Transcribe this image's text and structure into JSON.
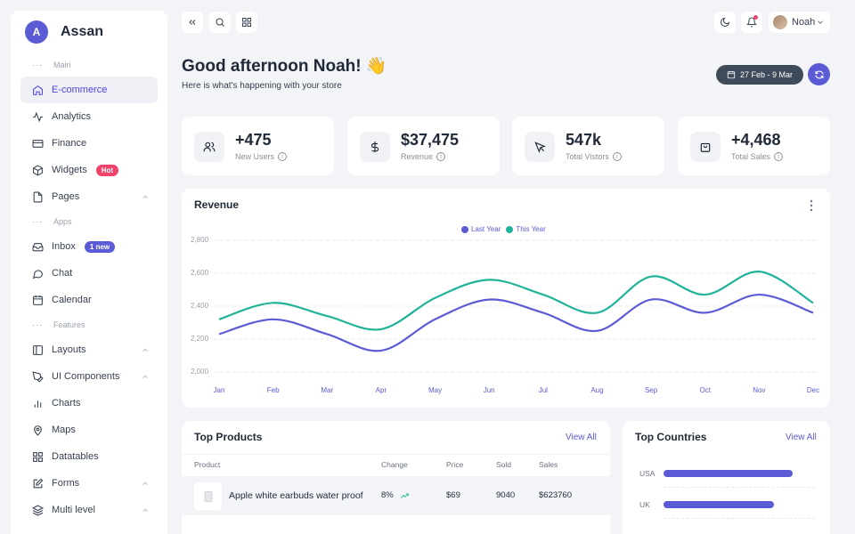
{
  "brand": {
    "initial": "A",
    "name": "Assan"
  },
  "sidebar": {
    "sections": [
      {
        "label": "Main"
      },
      {
        "label": "Apps"
      },
      {
        "label": "Features"
      }
    ],
    "items": [
      {
        "label": "E-commerce",
        "icon": "home-icon",
        "active": true
      },
      {
        "label": "Analytics",
        "icon": "activity-icon"
      },
      {
        "label": "Finance",
        "icon": "credit-card-icon"
      },
      {
        "label": "Widgets",
        "icon": "box-icon",
        "badge": "Hot"
      },
      {
        "label": "Pages",
        "icon": "file-icon",
        "has_chevron": true
      },
      {
        "label": "Inbox",
        "icon": "inbox-icon",
        "badge": "1 new"
      },
      {
        "label": "Chat",
        "icon": "message-icon"
      },
      {
        "label": "Calendar",
        "icon": "calendar-icon"
      },
      {
        "label": "Layouts",
        "icon": "layout-icon",
        "has_chevron": true
      },
      {
        "label": "UI Components",
        "icon": "pen-tool-icon",
        "has_chevron": true
      },
      {
        "label": "Charts",
        "icon": "bar-chart-icon"
      },
      {
        "label": "Maps",
        "icon": "map-pin-icon"
      },
      {
        "label": "Datatables",
        "icon": "grid-icon"
      },
      {
        "label": "Forms",
        "icon": "edit-icon",
        "has_chevron": true
      },
      {
        "label": "Multi level",
        "icon": "layers-icon",
        "has_chevron": true
      }
    ]
  },
  "topbar": {
    "user_name": "Noah"
  },
  "header": {
    "greeting": "Good afternoon Noah! 👋",
    "subtitle": "Here is what's happening with your store",
    "date_range": "27 Feb - 9 Mar"
  },
  "stats": [
    {
      "value": "+475",
      "label": "New Users",
      "icon": "users-icon"
    },
    {
      "value": "$37,475",
      "label": "Revenue",
      "icon": "dollar-icon"
    },
    {
      "value": "547k",
      "label": "Total Vistors",
      "icon": "cursor-icon"
    },
    {
      "value": "+4,468",
      "label": "Total Sales",
      "icon": "shopping-bag-icon"
    }
  ],
  "colors": {
    "accent": "#5b5bd6",
    "teal": "#20b39a",
    "hot": "#f0436a"
  },
  "chart_data": {
    "type": "line",
    "title": "Revenue",
    "categories": [
      "Jan",
      "Feb",
      "Mar",
      "Apr",
      "May",
      "Jun",
      "Jul",
      "Aug",
      "Sep",
      "Oct",
      "Nov",
      "Dec"
    ],
    "series": [
      {
        "name": "Last Year",
        "color": "#5b5bd6",
        "values": [
          2230,
          2320,
          2230,
          2130,
          2320,
          2440,
          2360,
          2250,
          2440,
          2360,
          2470,
          2360
        ]
      },
      {
        "name": "This Year",
        "color": "#20b39a",
        "values": [
          2320,
          2420,
          2340,
          2260,
          2450,
          2560,
          2470,
          2360,
          2580,
          2470,
          2610,
          2420
        ]
      }
    ],
    "yticks": [
      "2,800",
      "2,600",
      "2,400",
      "2,200",
      "2,000"
    ],
    "ylim": [
      2000,
      2800
    ],
    "legend_position": "top-center",
    "grid": true
  },
  "top_products": {
    "title": "Top Products",
    "view_all": "View All",
    "columns": [
      "Product",
      "Change",
      "Price",
      "Sold",
      "Sales"
    ],
    "rows": [
      {
        "product": "Apple white earbuds water proof",
        "change": "8%",
        "price": "$69",
        "sold": "9040",
        "sales": "$623760"
      }
    ]
  },
  "top_countries": {
    "title": "Top Countries",
    "view_all": "View All",
    "countries": [
      {
        "label": "USA",
        "value": 0.85
      },
      {
        "label": "UK",
        "value": 0.73
      }
    ]
  }
}
